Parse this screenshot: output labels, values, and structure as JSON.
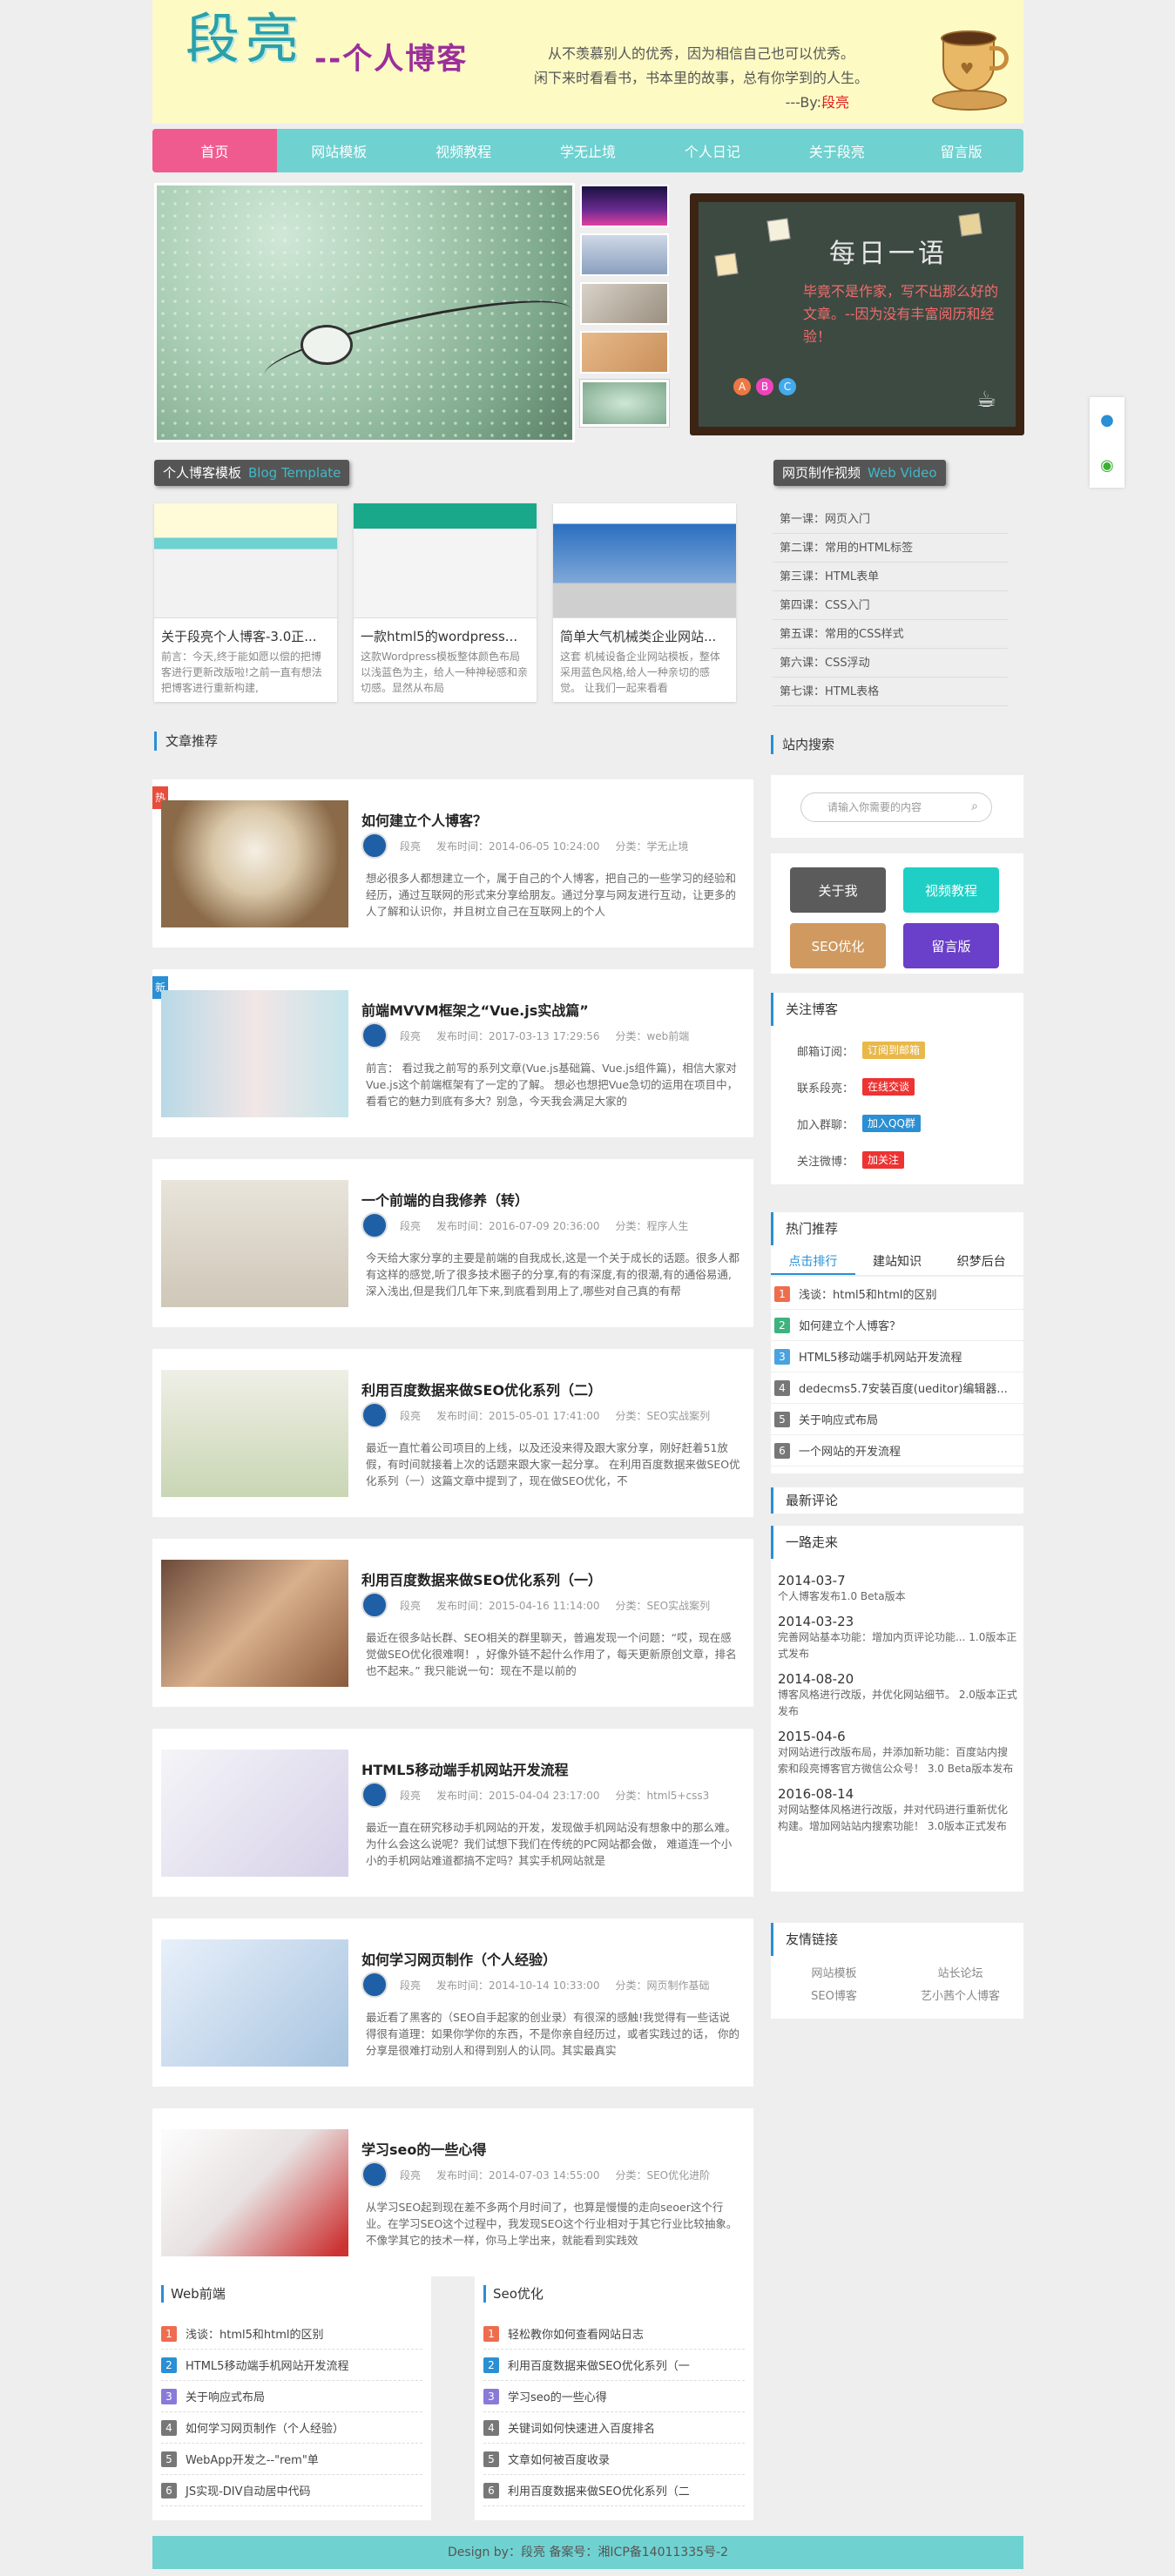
{
  "header": {
    "logo": "段亮",
    "logo_sub": "--个人博客",
    "intro_line1": "从不羡慕别人的优秀，因为相信自己也可以优秀。",
    "intro_line2": "闲下来时看看书，书本里的故事，总有你学到的人生。",
    "intro_sign_prefix": "---By:",
    "intro_sign_name": "段亮"
  },
  "nav": [
    "首页",
    "网站模板",
    "视频教程",
    "学无止境",
    "个人日记",
    "关于段亮",
    "留言版"
  ],
  "board": {
    "title": "每日一语",
    "text": "毕竟不是作家，写不出那么好的文章。--因为没有丰富阅历和经验！"
  },
  "sections": {
    "templates_label": "个人博客模板",
    "templates_label_en": "Blog Template",
    "video_label": "网页制作视频",
    "video_label_en": "Web Video",
    "recommend": "文章推荐"
  },
  "templates": [
    {
      "title": "关于段亮个人博客-3.0正...",
      "desc": "前言：今天,终于能如愿以偿的把博客进行更新改版啦!之前一直有想法把博客进行重新构建,"
    },
    {
      "title": "一款html5的wordpress...",
      "desc": "这款Wordpress模板整体颜色布局以浅蓝色为主，给人一种神秘感和亲切感。显然从布局"
    },
    {
      "title": "简单大气机械类企业网站...",
      "desc": "这套 机械设备企业网站模板，整体采用蓝色风格,给人一种亲切的感觉。 让我们一起来看看"
    }
  ],
  "lessons": [
    "第一课：网页入门",
    "第二课：常用的HTML标签",
    "第三课：HTML表单",
    "第四课：CSS入门",
    "第五课：常用的CSS样式",
    "第六课：CSS浮动",
    "第七课：HTML表格"
  ],
  "articles": [
    {
      "badge": "热",
      "badge_color": "#e84c3d",
      "title": "如何建立个人博客？",
      "author": "段亮",
      "time": "发布时间：2014-06-05 10:24:00",
      "cat": "分类：学无止境",
      "desc": "想必很多人都想建立一个，属于自己的个人博客，把自己的一些学习的经验和经历，通过互联网的形式来分享给朋友。通过分享与网友进行互动，让更多的人了解和认识你，并且树立自己在互联网上的个人"
    },
    {
      "badge": "新",
      "badge_color": "#2a8fd4",
      "title": "前端MVVM框架之“Vue.js实战篇”",
      "author": "段亮",
      "time": "发布时间：2017-03-13 17:29:56",
      "cat": "分类：web前端",
      "desc": "前言： 看过我之前写的系列文章(Vue.js基础篇、Vue.js组件篇)，相信大家对Vue.js这个前端框架有了一定的了解。 想必也想把Vue急切的运用在项目中，看看它的魅力到底有多大？别急，今天我会满足大家的"
    },
    {
      "badge": "",
      "badge_color": "",
      "title": "一个前端的自我修养（转）",
      "author": "段亮",
      "time": "发布时间：2016-07-09 20:36:00",
      "cat": "分类：程序人生",
      "desc": "今天给大家分享的主要是前端的自我成长,这是一个关于成长的话题。很多人都有这样的感觉,听了很多技术圈子的分享,有的有深度,有的很潮,有的通俗易通,深入浅出,但是我们几年下来,到底看到用上了,哪些对自己真的有帮"
    },
    {
      "badge": "",
      "badge_color": "",
      "title": "利用百度数据来做SEO优化系列（二）",
      "author": "段亮",
      "time": "发布时间：2015-05-01 17:41:00",
      "cat": "分类：SEO实战案列",
      "desc": "最近一直忙着公司项目的上线，以及还没来得及跟大家分享，刚好赶着51放假，有时间就接着上次的话题来跟大家一起分享。 在利用百度数据来做SEO优化系列（一）这篇文章中提到了，现在做SEO优化，不"
    },
    {
      "badge": "",
      "badge_color": "",
      "title": "利用百度数据来做SEO优化系列（一）",
      "author": "段亮",
      "time": "发布时间：2015-04-16 11:14:00",
      "cat": "分类：SEO实战案列",
      "desc": "最近在很多站长群、SEO相关的群里聊天，普遍发现一个问题：“哎，现在感觉做SEO优化很难啊！，好像外链不起什么作用了，每天更新原创文章，排名也不起来。” 我只能说一句：现在不是以前的"
    },
    {
      "badge": "",
      "badge_color": "",
      "title": "HTML5移动端手机网站开发流程",
      "author": "段亮",
      "time": "发布时间：2015-04-04 23:17:00",
      "cat": "分类：html5+css3",
      "desc": "最近一直在研究移动手机网站的开发，发现做手机网站没有想象中的那么难。为什么会这么说呢？我们试想下我们在传统的PC网站都会做， 难道连一个小小的手机网站难道都搞不定吗？其实手机网站就是"
    },
    {
      "badge": "",
      "badge_color": "",
      "title": "如何学习网页制作（个人经验）",
      "author": "段亮",
      "time": "发布时间：2014-10-14 10:33:00",
      "cat": "分类：网页制作基础",
      "desc": "最近看了黑客的（SEO自手起家的创业录）有很深的感触!我觉得有一些话说得很有道理：如果你学你的东西，不是你亲自经历过，或者实践过的话， 你的分享是很难打动别人和得到别人的认同。其实最真实"
    },
    {
      "badge": "",
      "badge_color": "",
      "title": "学习seo的一些心得",
      "author": "段亮",
      "time": "发布时间：2014-07-03 14:55:00",
      "cat": "分类：SEO优化进阶",
      "desc": "从学习SEO起到现在差不多两个月时间了，也算是慢慢的走向seoer这个行业。在学习SEO这个过程中，我发现SEO这个行业相对于其它行业比较抽象。不像学其它的技术一样，你马上学出来，就能看到实践效"
    }
  ],
  "sidebar": {
    "search_title": "站内搜索",
    "search_placeholder": "请输入你需要的内容",
    "buttons": [
      "关于我",
      "视频教程",
      "SEO优化",
      "留言版"
    ],
    "follow_title": "关注博客",
    "follow": [
      {
        "label": "邮箱订阅：",
        "tag": "订阅到邮箱",
        "color": "#e8b84a"
      },
      {
        "label": "联系段亮：",
        "tag": "在线交谈",
        "color": "#e33"
      },
      {
        "label": "加入群聊：",
        "tag": "加入QQ群",
        "color": "#2a8fd4"
      },
      {
        "label": "关注微博：",
        "tag": "加关注",
        "color": "#e33"
      }
    ],
    "hot_title": "热门推荐",
    "hot_tabs": [
      "点击排行",
      "建站知识",
      "织梦后台"
    ],
    "hot": [
      "浅谈：html5和html的区别",
      "如何建立个人博客？",
      "HTML5移动端手机网站开发流程",
      "dedecms5.7安装百度(ueditor)编辑器...",
      "关于响应式布局",
      "一个网站的开发流程"
    ],
    "comments_title": "最新评论",
    "timeline_title": "一路走来",
    "timeline": [
      {
        "date": "2014-03-7",
        "text": "个人博客发布1.0 Beta版本"
      },
      {
        "date": "2014-03-23",
        "text": "完善网站基本功能：增加内页评论功能... 1.0版本正式发布"
      },
      {
        "date": "2014-08-20",
        "text": "博客风格进行改版，并优化网站细节。 2.0版本正式发布"
      },
      {
        "date": "2015-04-6",
        "text": "对网站进行改版布局，并添加新功能：百度站内搜索和段亮博客官方微信公众号！ 3.0 Beta版本发布"
      },
      {
        "date": "2016-08-14",
        "text": "对网站整体风格进行改版，并对代码进行重新优化构建。增加网站站内搜索功能！ 3.0版本正式发布"
      }
    ],
    "links_title": "友情链接",
    "links": [
      "网站模板",
      "站长论坛",
      "SEO博客",
      "艺小茜个人博客"
    ]
  },
  "bottom": {
    "web_title": "Web前端",
    "web": [
      "浅谈：html5和html的区别",
      "HTML5移动端手机网站开发流程",
      "关于响应式布局",
      "如何学习网页制作（个人经验）",
      "WebApp开发之--\"rem\"单",
      "JS实现-DIV自动居中代码"
    ],
    "seo_title": "Seo优化",
    "seo": [
      "轻松教你如何查看网站日志",
      "利用百度数据来做SEO优化系列（一",
      "学习seo的一些心得",
      "关键词如何快速进入百度排名",
      "文章如何被百度收录",
      "利用百度数据来做SEO优化系列（二"
    ]
  },
  "footer": "Design by：段亮   备案号：湘ICP备14011335号-2",
  "colors": {
    "accent": "#6fd1d0",
    "active": "#f05b8f",
    "link": "#2a8fd4"
  }
}
